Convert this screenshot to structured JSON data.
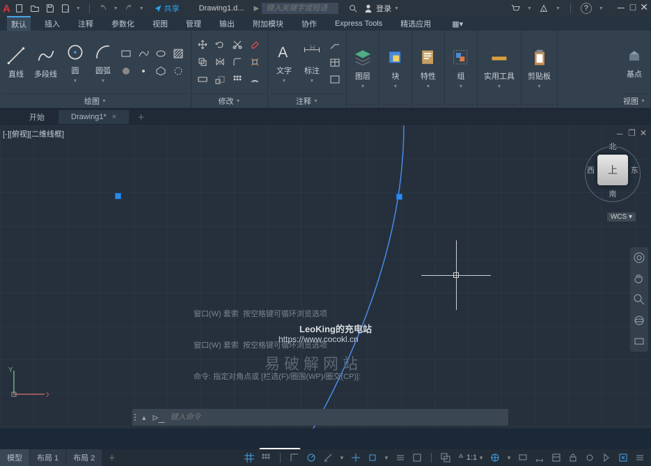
{
  "titlebar": {
    "share": "共享",
    "doc_name": "Drawing1.d...",
    "search_placeholder": "键入关键字或短语",
    "login": "登录"
  },
  "ribbon_tabs": [
    "默认",
    "插入",
    "注释",
    "参数化",
    "视图",
    "管理",
    "输出",
    "附加模块",
    "协作",
    "Express Tools",
    "精选应用"
  ],
  "ribbon": {
    "draw": {
      "line": "直线",
      "pline": "多段线",
      "circle": "圆",
      "arc": "圆弧",
      "title": "绘图"
    },
    "modify": {
      "title": "修改"
    },
    "annot": {
      "text": "文字",
      "dim": "标注",
      "title": "注释"
    },
    "layers": {
      "label": "图层"
    },
    "block": {
      "label": "块"
    },
    "props": {
      "label": "特性"
    },
    "group": {
      "label": "组"
    },
    "util": {
      "label": "实用工具"
    },
    "clip": {
      "label": "剪贴板"
    },
    "view": {
      "basepoint": "基点",
      "title": "视图"
    }
  },
  "file_tabs": {
    "start": "开始",
    "drawing": "Drawing1*"
  },
  "viewport": {
    "label": "[-][俯视][二维线框]"
  },
  "viewcube": {
    "n": "北",
    "s": "南",
    "e": "东",
    "w": "西",
    "top": "上",
    "wcs": "WCS"
  },
  "cmd_history": [
    "窗口(W) 套索  按空格键可循环浏览选项",
    "窗口(W) 套索  按空格键可循环浏览选项",
    "命令: 指定对角点或 [栏选(F)/圈围(WP)/圈交(CP)]:"
  ],
  "cmd_placeholder": "键入命令",
  "watermark_cn": "易破解网站",
  "overlay": {
    "title": "LeoKing的充电站",
    "url": "https://www.cocokl.cn"
  },
  "status": {
    "model": "模型",
    "layout1": "布局 1",
    "layout2": "布局 2",
    "scale": "1:1"
  }
}
